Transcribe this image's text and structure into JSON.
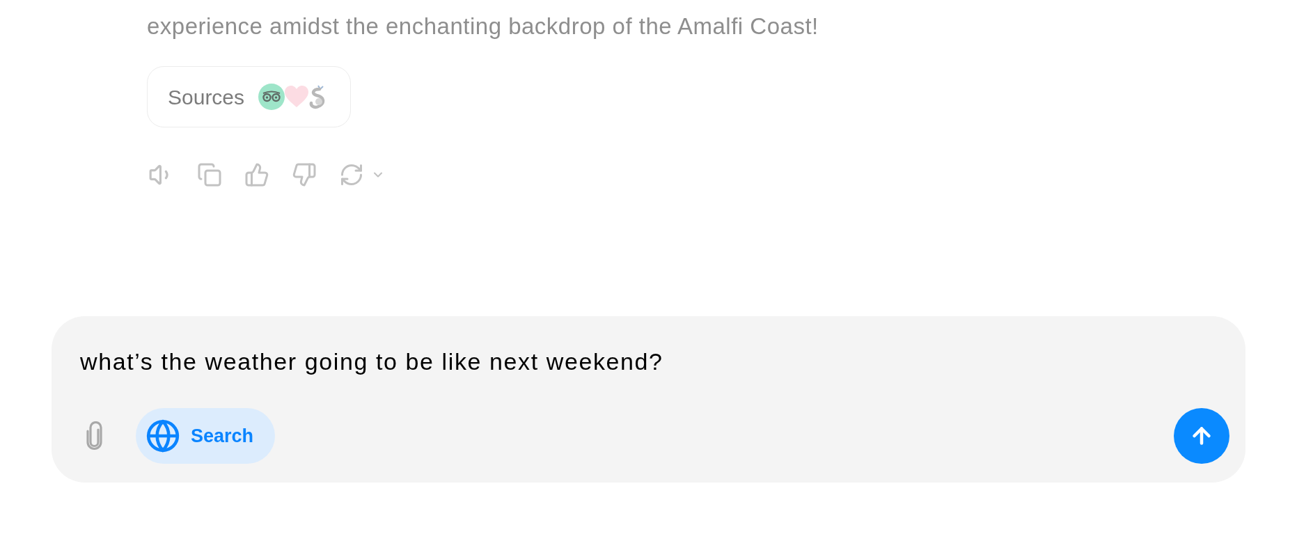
{
  "message": {
    "text": "experience amidst the enchanting backdrop of the Amalfi Coast!",
    "sources": {
      "label": "Sources"
    }
  },
  "composer": {
    "value": "what’s the weather going to be like next weekend?",
    "search": {
      "label": "Search",
      "selected": true
    }
  }
}
